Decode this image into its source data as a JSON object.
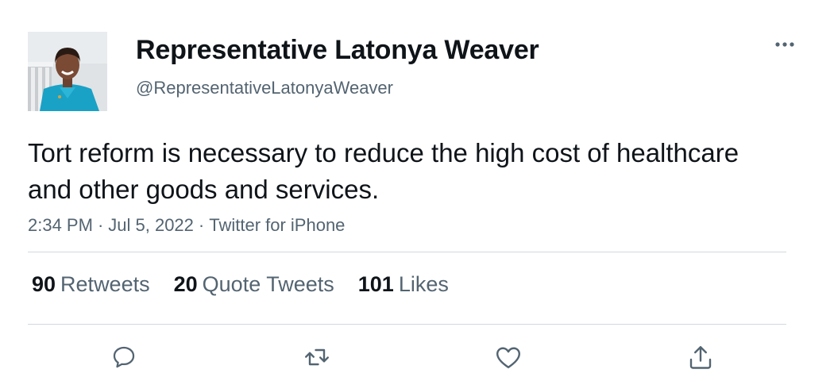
{
  "author": {
    "display_name": "Representative Latonya Weaver",
    "handle": "@RepresentativeLatonyaWeaver"
  },
  "tweet": {
    "text": "Tort reform is necessary to reduce the high cost of healthcare and other goods and services.",
    "time": "2:34 PM",
    "date": "Jul 5, 2022",
    "source": "Twitter for iPhone",
    "separator": "·"
  },
  "stats": {
    "retweets_count": "90",
    "retweets_label": "Retweets",
    "quotes_count": "20",
    "quotes_label": "Quote Tweets",
    "likes_count": "101",
    "likes_label": "Likes"
  },
  "icons": {
    "more": "more-horizontal-icon",
    "reply": "reply-icon",
    "retweet": "retweet-icon",
    "like": "heart-icon",
    "share": "share-icon"
  },
  "colors": {
    "text_primary": "#0f1419",
    "text_secondary": "#536471",
    "divider": "#cfd9de",
    "icon": "#536471"
  }
}
